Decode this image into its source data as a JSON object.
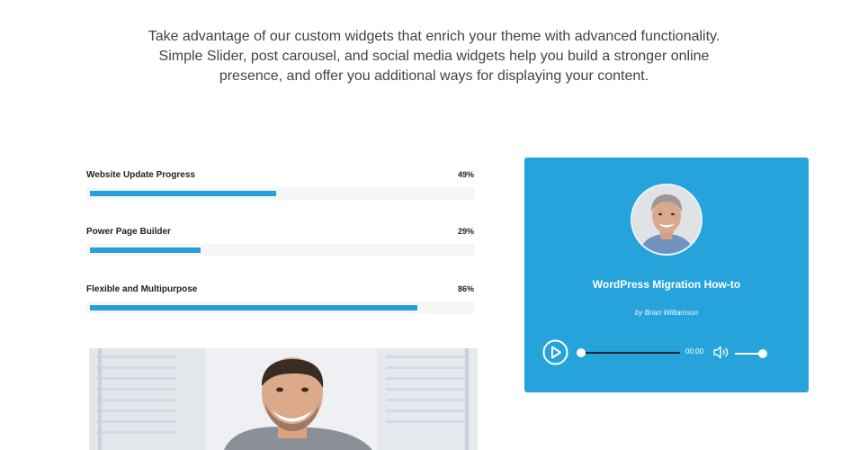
{
  "intro": {
    "line1": "Take advantage of our custom widgets that enrich your theme with advanced functionality.",
    "line2": "Simple Slider, post carousel, and social media widgets help you build a stronger online",
    "line3": "presence, and offer you additional ways for displaying your content."
  },
  "progress": [
    {
      "label": "Website Update Progress",
      "percent_text": "49%",
      "percent": 49
    },
    {
      "label": "Power Page Builder",
      "percent_text": "29%",
      "percent": 29
    },
    {
      "label": "Flexible and Multipurpose",
      "percent_text": "86%",
      "percent": 86
    }
  ],
  "audio": {
    "title": "WordPress Migration How-to",
    "author": "by Brian Williamson",
    "time": "00:00",
    "seek_fraction": 0,
    "volume_fraction": 1
  },
  "colors": {
    "accent": "#26a0da",
    "card": "#26a3da"
  },
  "icons": {
    "play": "play-circle-icon",
    "volume": "speaker-icon"
  }
}
